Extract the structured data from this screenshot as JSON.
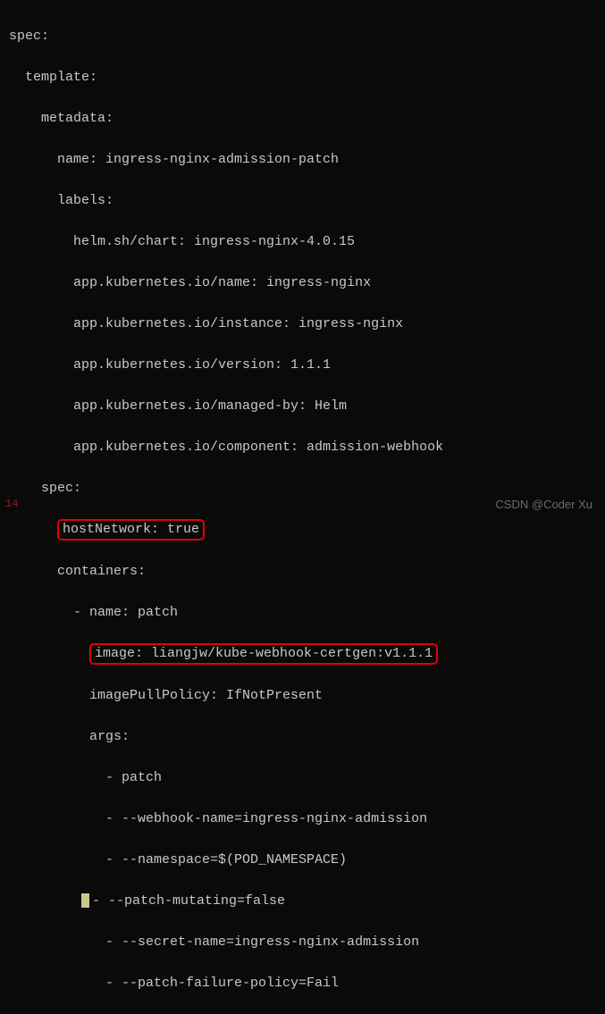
{
  "code": {
    "l01": "spec:",
    "l02": "  template:",
    "l03": "    metadata:",
    "l04": "      name: ingress-nginx-admission-patch",
    "l05": "      labels:",
    "l06": "        helm.sh/chart: ingress-nginx-4.0.15",
    "l07": "        app.kubernetes.io/name: ingress-nginx",
    "l08": "        app.kubernetes.io/instance: ingress-nginx",
    "l09": "        app.kubernetes.io/version: 1.1.1",
    "l10": "        app.kubernetes.io/managed-by: Helm",
    "l11": "        app.kubernetes.io/component: admission-webhook",
    "l12": "    spec:",
    "l13_pre": "      ",
    "l13_hl": "hostNetwork: true",
    "l14": "      containers:",
    "l15": "        - name: patch",
    "l16_pre": "          ",
    "l16_hl": "image: liangjw/kube-webhook-certgen:v1.1.1",
    "l17": "          imagePullPolicy: IfNotPresent",
    "l18": "          args:",
    "l19": "            - patch",
    "l20": "            - --webhook-name=ingress-nginx-admission",
    "l21": "            - --namespace=$(POD_NAMESPACE)",
    "l22_pre": "         ",
    "l22_post": "- --patch-mutating=false",
    "l23": "            - --secret-name=ingress-nginx-admission",
    "l24": "            - --patch-failure-policy=Fail"
  },
  "watermark": "CSDN @Coder Xu",
  "line_num": "14"
}
